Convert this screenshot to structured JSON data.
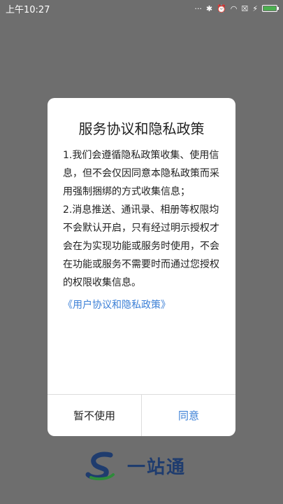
{
  "status_bar": {
    "time": "上午10:27"
  },
  "dialog": {
    "title": "服务协议和隐私政策",
    "paragraphs": [
      "1.我们会遵循隐私政策收集、使用信息，但不会仅因同意本隐私政策而采用强制捆绑的方式收集信息；",
      "2.消息推送、通讯录、相册等权限均不会默认开启，只有经过明示授权才会在为实现功能或服务时使用，不会在功能或服务不需要时而通过您授权的权限收集信息。"
    ],
    "policy_link": "《用户协议和隐私政策》",
    "cancel_label": "暂不使用",
    "ok_label": "同意"
  },
  "brand": {
    "name": "一站通",
    "colors": {
      "navy": "#1f3c6e",
      "green": "#2e8b3a"
    }
  },
  "colors": {
    "accent": "#3b7fd6",
    "overlay": "#6e6e6e"
  }
}
